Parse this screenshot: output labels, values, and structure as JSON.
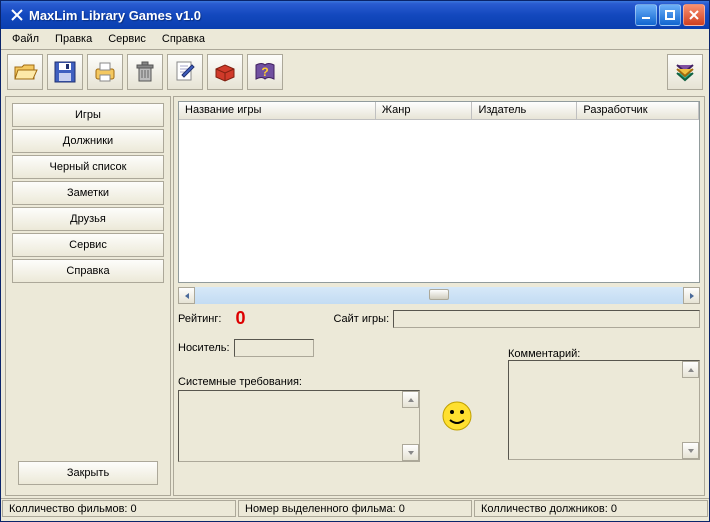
{
  "window": {
    "title": "MaxLim Library Games v1.0"
  },
  "menu": {
    "items": [
      "Файл",
      "Правка",
      "Сервис",
      "Справка"
    ]
  },
  "toolbar_icons": [
    "open-icon",
    "save-icon",
    "print-icon",
    "delete-icon",
    "note-icon",
    "box-icon",
    "help-icon"
  ],
  "sidebar": {
    "items": [
      "Игры",
      "Должники",
      "Черный список",
      "Заметки",
      "Друзья",
      "Сервис",
      "Справка"
    ],
    "close_label": "Закрыть"
  },
  "table": {
    "columns": [
      "Название игры",
      "Жанр",
      "Издатель",
      "Разработчик"
    ],
    "rows": []
  },
  "details": {
    "rating_label": "Рейтинг:",
    "rating_value": "0",
    "site_label": "Сайт игры:",
    "site_value": "",
    "media_label": "Носитель:",
    "media_value": "",
    "comment_label": "Комментарий:",
    "comment_value": "",
    "sysreq_label": "Системные требования:",
    "sysreq_value": ""
  },
  "status": {
    "films_count": "Колличество фильмов: 0",
    "selected_film": "Номер выделенного фильма: 0",
    "debtors_count": "Колличество  должников: 0"
  }
}
